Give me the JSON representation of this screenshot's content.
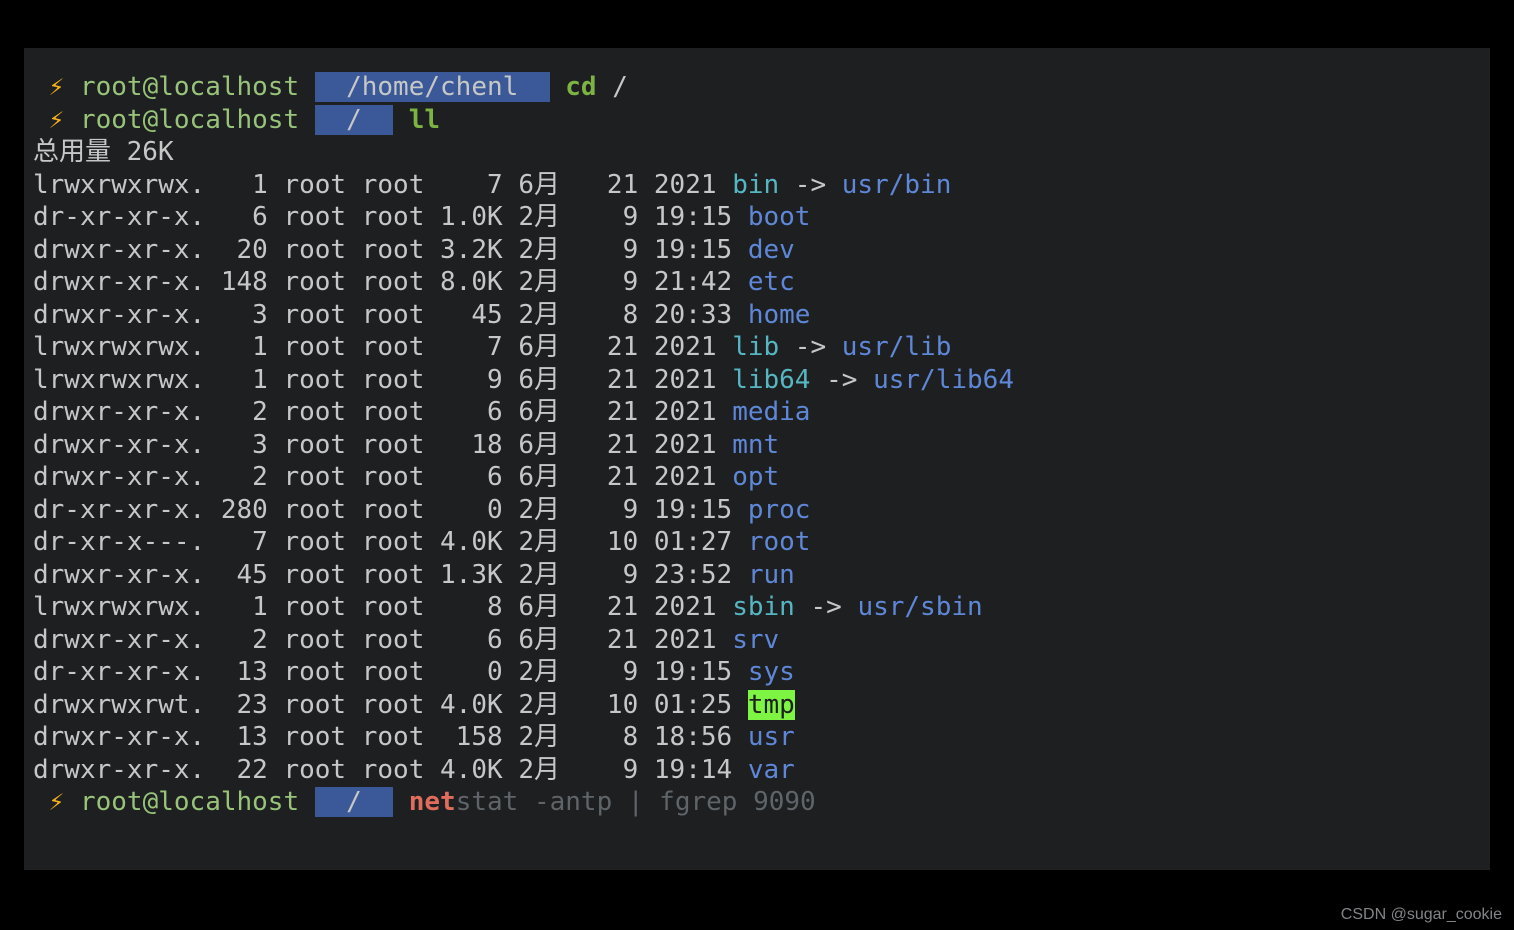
{
  "prompt_symbol": "⚡ ",
  "p1": {
    "userhost": "root@localhost",
    "path": "/home/chenl",
    "cmd": "cd",
    "arg": "/"
  },
  "p2": {
    "userhost": "root@localhost",
    "path": "/",
    "cmd": "ll"
  },
  "total_label": "总用量 ",
  "total_value": "26K",
  "rows": [
    {
      "perm": "lrwxrwxrwx.",
      "links": "  1",
      "own": "root",
      "grp": "root",
      "size": "   7",
      "mon": "6月 ",
      "day": " 21",
      "time": "2021",
      "name": "bin",
      "nclass": "symlink",
      "arrow": " -> ",
      "target": "usr/bin",
      "tclass": "dirlink"
    },
    {
      "perm": "dr-xr-xr-x.",
      "links": "  6",
      "own": "root",
      "grp": "root",
      "size": "1.0K",
      "mon": "2月 ",
      "day": "  9",
      "time": "19:15",
      "name": "boot",
      "nclass": "dirlink"
    },
    {
      "perm": "drwxr-xr-x.",
      "links": " 20",
      "own": "root",
      "grp": "root",
      "size": "3.2K",
      "mon": "2月 ",
      "day": "  9",
      "time": "19:15",
      "name": "dev",
      "nclass": "dirlink"
    },
    {
      "perm": "drwxr-xr-x.",
      "links": "148",
      "own": "root",
      "grp": "root",
      "size": "8.0K",
      "mon": "2月 ",
      "day": "  9",
      "time": "21:42",
      "name": "etc",
      "nclass": "dirlink"
    },
    {
      "perm": "drwxr-xr-x.",
      "links": "  3",
      "own": "root",
      "grp": "root",
      "size": "  45",
      "mon": "2月 ",
      "day": "  8",
      "time": "20:33",
      "name": "home",
      "nclass": "dirlink"
    },
    {
      "perm": "lrwxrwxrwx.",
      "links": "  1",
      "own": "root",
      "grp": "root",
      "size": "   7",
      "mon": "6月 ",
      "day": " 21",
      "time": "2021",
      "name": "lib",
      "nclass": "symlink",
      "arrow": " -> ",
      "target": "usr/lib",
      "tclass": "dirlink"
    },
    {
      "perm": "lrwxrwxrwx.",
      "links": "  1",
      "own": "root",
      "grp": "root",
      "size": "   9",
      "mon": "6月 ",
      "day": " 21",
      "time": "2021",
      "name": "lib64",
      "nclass": "symlink",
      "arrow": " -> ",
      "target": "usr/lib64",
      "tclass": "dirlink"
    },
    {
      "perm": "drwxr-xr-x.",
      "links": "  2",
      "own": "root",
      "grp": "root",
      "size": "   6",
      "mon": "6月 ",
      "day": " 21",
      "time": "2021",
      "name": "media",
      "nclass": "dirlink"
    },
    {
      "perm": "drwxr-xr-x.",
      "links": "  3",
      "own": "root",
      "grp": "root",
      "size": "  18",
      "mon": "6月 ",
      "day": " 21",
      "time": "2021",
      "name": "mnt",
      "nclass": "dirlink"
    },
    {
      "perm": "drwxr-xr-x.",
      "links": "  2",
      "own": "root",
      "grp": "root",
      "size": "   6",
      "mon": "6月 ",
      "day": " 21",
      "time": "2021",
      "name": "opt",
      "nclass": "dirlink"
    },
    {
      "perm": "dr-xr-xr-x.",
      "links": "280",
      "own": "root",
      "grp": "root",
      "size": "   0",
      "mon": "2月 ",
      "day": "  9",
      "time": "19:15",
      "name": "proc",
      "nclass": "dirlink"
    },
    {
      "perm": "dr-xr-x---.",
      "links": "  7",
      "own": "root",
      "grp": "root",
      "size": "4.0K",
      "mon": "2月 ",
      "day": " 10",
      "time": "01:27",
      "name": "root",
      "nclass": "dirlink"
    },
    {
      "perm": "drwxr-xr-x.",
      "links": " 45",
      "own": "root",
      "grp": "root",
      "size": "1.3K",
      "mon": "2月 ",
      "day": "  9",
      "time": "23:52",
      "name": "run",
      "nclass": "dirlink"
    },
    {
      "perm": "lrwxrwxrwx.",
      "links": "  1",
      "own": "root",
      "grp": "root",
      "size": "   8",
      "mon": "6月 ",
      "day": " 21",
      "time": "2021",
      "name": "sbin",
      "nclass": "symlink",
      "arrow": " -> ",
      "target": "usr/sbin",
      "tclass": "dirlink"
    },
    {
      "perm": "drwxr-xr-x.",
      "links": "  2",
      "own": "root",
      "grp": "root",
      "size": "   6",
      "mon": "6月 ",
      "day": " 21",
      "time": "2021",
      "name": "srv",
      "nclass": "dirlink"
    },
    {
      "perm": "dr-xr-xr-x.",
      "links": " 13",
      "own": "root",
      "grp": "root",
      "size": "   0",
      "mon": "2月 ",
      "day": "  9",
      "time": "19:15",
      "name": "sys",
      "nclass": "dirlink"
    },
    {
      "perm": "drwxrwxrwt.",
      "links": " 23",
      "own": "root",
      "grp": "root",
      "size": "4.0K",
      "mon": "2月 ",
      "day": " 10",
      "time": "01:25",
      "name": "tmp",
      "nclass": "tmp"
    },
    {
      "perm": "drwxr-xr-x.",
      "links": " 13",
      "own": "root",
      "grp": "root",
      "size": " 158",
      "mon": "2月 ",
      "day": "  8",
      "time": "18:56",
      "name": "usr",
      "nclass": "dirlink"
    },
    {
      "perm": "drwxr-xr-x.",
      "links": " 22",
      "own": "root",
      "grp": "root",
      "size": "4.0K",
      "mon": "2月 ",
      "day": "  9",
      "time": "19:14",
      "name": "var",
      "nclass": "dirlink"
    }
  ],
  "p3": {
    "userhost": "root@localhost",
    "path": "/",
    "typed": "net",
    "suggest": "stat -antp | fgrep 9090"
  },
  "watermark": "CSDN @sugar_cookie"
}
